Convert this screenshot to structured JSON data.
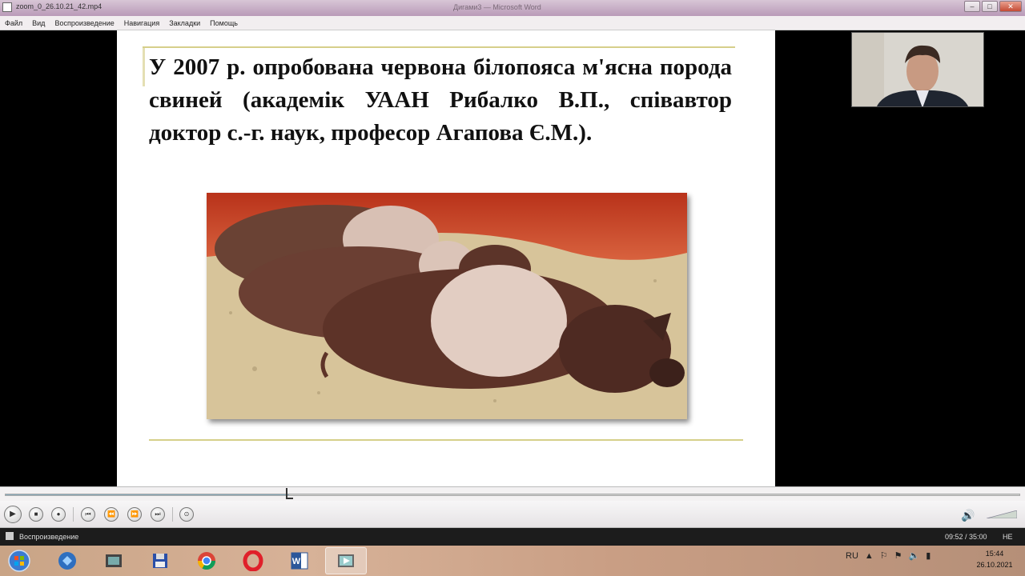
{
  "window": {
    "filename": "zoom_0_26.10.21_42.mp4",
    "title": "Дигами3 — Microsoft Word"
  },
  "menu": [
    "Файл",
    "Вид",
    "Воспроизведение",
    "Навигация",
    "Закладки",
    "Помощь"
  ],
  "slide": {
    "text": "У 2007 р. опробована червона білопояса м'ясна порода свиней (академік УААН Рибалко В.П., співавтор доктор с.-г. наук, професор Агапова Є.М.)."
  },
  "player": {
    "progress_fraction": 0.28,
    "buttons": [
      "play-pause",
      "stop",
      "record",
      "previous",
      "rewind",
      "fast-forward",
      "next",
      "zoom"
    ],
    "status_text": "Воспроизведение",
    "time": "09:52 / 35:00",
    "speed": "НЕ"
  },
  "taskbar": {
    "apps": [
      "explorer",
      "windows-media-center",
      "floppy-save",
      "chrome",
      "opera",
      "word",
      "media-player"
    ],
    "tray_lang": "RU",
    "clock_time": "15:44",
    "clock_date": "26.10.2021"
  },
  "colors": {
    "accent_line": "#d6cf8a",
    "taskbar": "#c9a486",
    "titlebar": "#b99ab8"
  }
}
